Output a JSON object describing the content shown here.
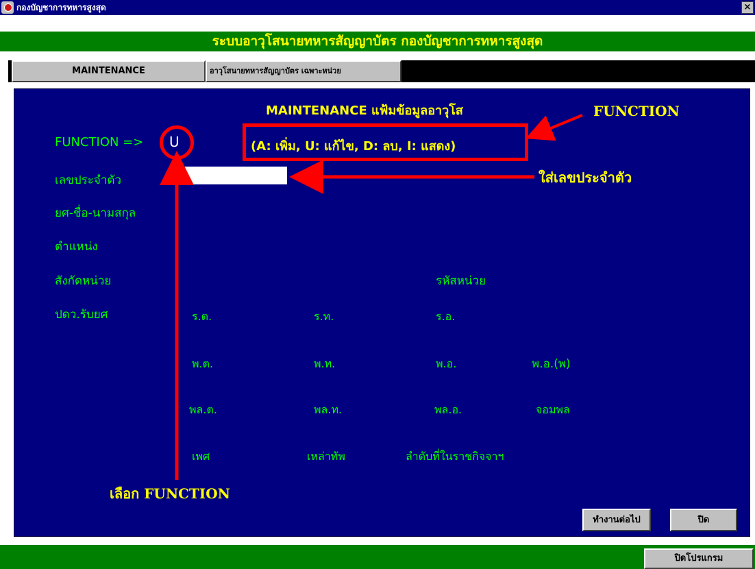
{
  "window": {
    "title": "กองบัญชาการทหารสูงสุด",
    "close_symbol": "×"
  },
  "header": {
    "title": "ระบบอาวุโสนายทหารสัญญาบัตร กองบัญชาการทหารสูงสุด"
  },
  "tabs": [
    {
      "label": "MAINTENANCE"
    },
    {
      "label": "อาวุโสนายทหารสัญญาบัตร เฉพาะหน่วย"
    }
  ],
  "form": {
    "title": "MAINTENANCE แฟ้มข้อมูลอาวุโส",
    "function_label": "FUNCTION =>",
    "function_value": "U",
    "function_options": "(A: เพิ่ม,  U: แก้ไข,  D: ลบ,  I: แสดง)",
    "id_label": "เลขประจำตัว",
    "id_value": "",
    "name_label": "ยศ-ชื่อ-นามสกุล",
    "position_label": "ตำแหน่ง",
    "unit_label": "สังกัดหน่วย",
    "unit_code_label": "รหัสหน่วย",
    "promo_label": "ปดว.รับยศ",
    "ranks": [
      "ร.ต.",
      "ร.ท.",
      "ร.อ.",
      "พ.ต.",
      "พ.ท.",
      "พ.อ.",
      "พ.อ.(พ)",
      "พล.ต.",
      "พล.ท.",
      "พล.อ.",
      "จอมพล"
    ],
    "sex_label": "เพศ",
    "branch_label": "เหล่าทัพ",
    "order_label": "ลำดับที่ในราชกิจจาฯ"
  },
  "buttons": {
    "continue": "ทำงานต่อไป",
    "close": "ปิด",
    "exit": "ปิดโปรแกรม"
  },
  "annotations": {
    "function": "FUNCTION",
    "enter_id": "ใส่เลขประจำตัว",
    "choose_function": "เลือก FUNCTION"
  },
  "colors": {
    "panel": "#000080",
    "header": "#008000",
    "label_yellow": "#ffff00",
    "label_green": "#00ff00",
    "annotation_red": "#ff0000"
  }
}
